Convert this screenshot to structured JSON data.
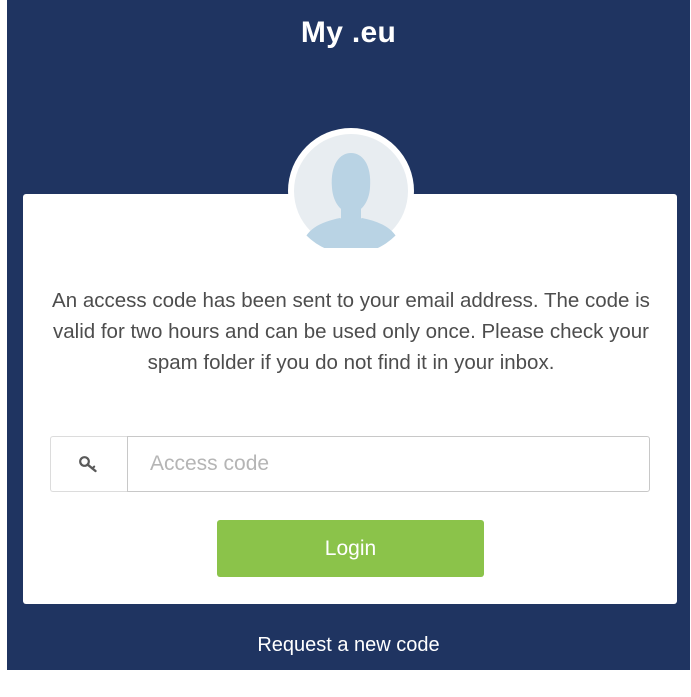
{
  "header": {
    "title": "My .eu"
  },
  "card": {
    "avatar_icon": "user-silhouette-icon",
    "message": "An access code has been sent to your email address. The code is valid for two hours and can be used only once. Please check your spam folder if you do not find it in your inbox.",
    "access_code": {
      "icon": "key-icon",
      "placeholder": "Access code",
      "value": ""
    },
    "login_label": "Login"
  },
  "footer": {
    "request_link": "Request a new code"
  },
  "colors": {
    "background": "#1f3461",
    "card": "#ffffff",
    "button": "#8bc34a",
    "avatar_bg": "#e8edf1",
    "avatar_figure": "#b9d3e4"
  }
}
